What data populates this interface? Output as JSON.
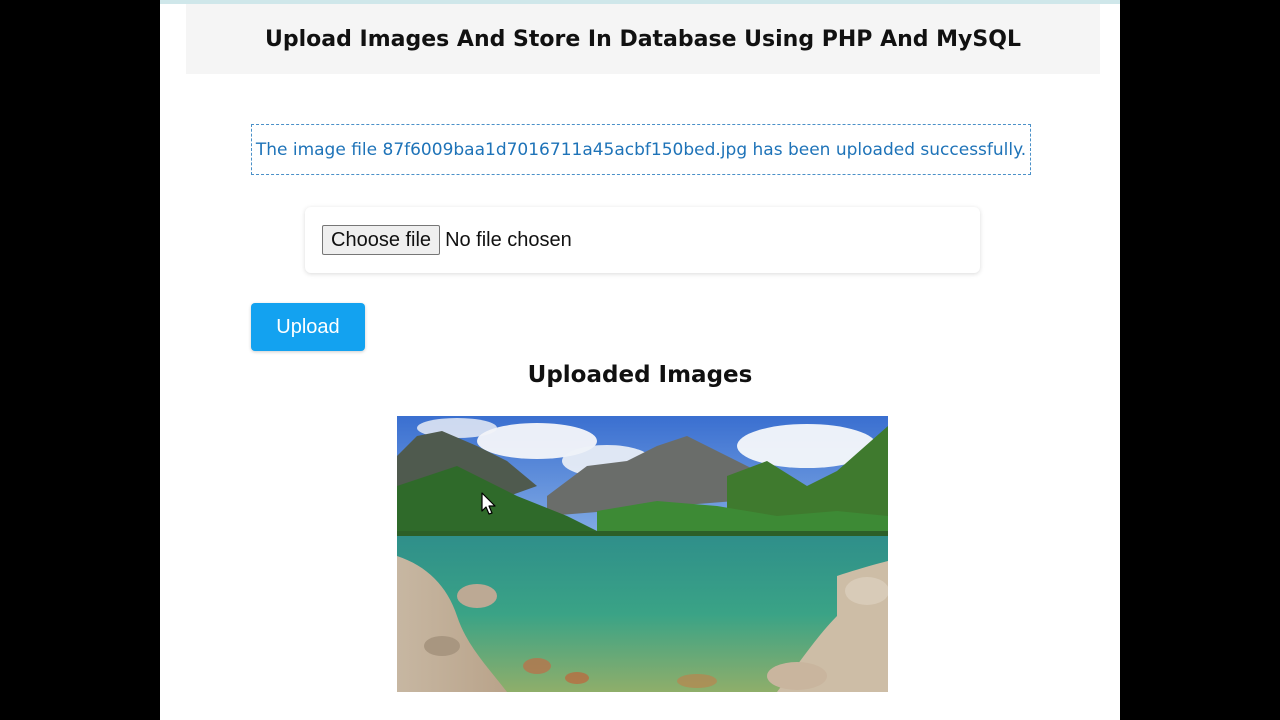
{
  "header": {
    "title": "Upload Images And Store In Database Using PHP And MySQL"
  },
  "alert": {
    "message": "The image file 87f6009baa1d7016711a45acbf150bed.jpg has been uploaded successfully."
  },
  "file_input": {
    "button_label": "Choose file",
    "status": "No file chosen"
  },
  "upload_button": {
    "label": "Upload"
  },
  "gallery": {
    "title": "Uploaded Images"
  },
  "colors": {
    "upload_button": "#13a2f0",
    "alert_text": "#1e73b8",
    "alert_border": "#4a90c8",
    "header_background": "#f5f5f5"
  },
  "icons": [
    "mouse-cursor-icon"
  ]
}
